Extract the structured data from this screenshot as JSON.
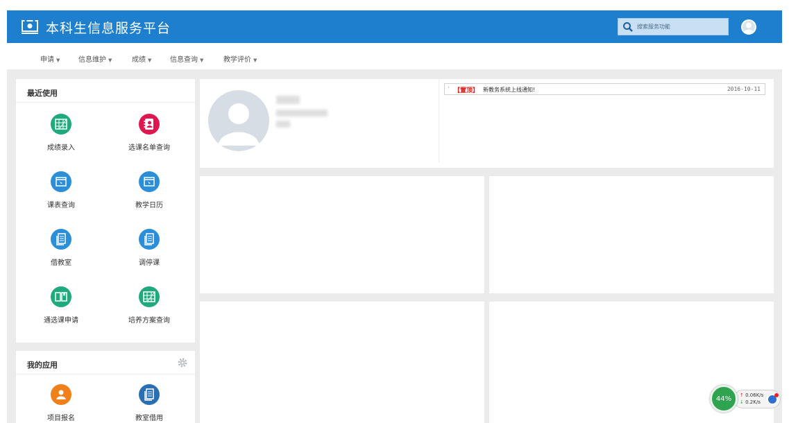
{
  "header": {
    "title": "本科生信息服务平台",
    "search_placeholder": "搜索服务功能",
    "colors": {
      "header_bg": "#1e7fcf"
    }
  },
  "nav": [
    {
      "label": "申请"
    },
    {
      "label": "信息维护"
    },
    {
      "label": "成绩"
    },
    {
      "label": "信息查询"
    },
    {
      "label": "教学评价"
    }
  ],
  "recent": {
    "title": "最近使用",
    "apps": [
      {
        "label": "成绩录入",
        "icon": "grid-icon",
        "color": "#1eaa7c"
      },
      {
        "label": "选课名单查询",
        "icon": "contacts-icon",
        "color": "#e0174f"
      },
      {
        "label": "课表查询",
        "icon": "window-icon",
        "color": "#2b8ed8"
      },
      {
        "label": "教学日历",
        "icon": "window-icon",
        "color": "#2b8ed8"
      },
      {
        "label": "借教室",
        "icon": "document-icon",
        "color": "#2b8ed8"
      },
      {
        "label": "调停课",
        "icon": "document-icon",
        "color": "#2b8ed8"
      },
      {
        "label": "通选课申请",
        "icon": "book-icon",
        "color": "#1eaa7c"
      },
      {
        "label": "培养方案查询",
        "icon": "grid-icon",
        "color": "#1eaa7c"
      }
    ]
  },
  "myapps": {
    "title": "我的应用",
    "apps": [
      {
        "label": "项目报名",
        "icon": "user-icon",
        "color": "#f08019"
      },
      {
        "label": "教室借用",
        "icon": "document-icon",
        "color": "#2b6fb3"
      }
    ]
  },
  "notice": {
    "tag": "【置顶】",
    "text": "新教务系统上线通知!",
    "date": "2016-10-11"
  },
  "speed_widget": {
    "percent": "44%",
    "upload": "0.06K/s",
    "download": "0.2K/s"
  }
}
